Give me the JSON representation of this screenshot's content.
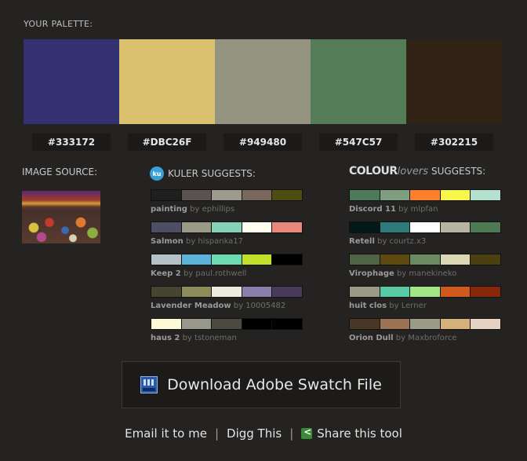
{
  "palette": {
    "heading": "YOUR PALETTE:",
    "colors": [
      "#333172",
      "#DBC26F",
      "#949480",
      "#547C57",
      "#302215"
    ]
  },
  "image_source": {
    "title": "IMAGE SOURCE:"
  },
  "kuler": {
    "icon_text": "ku",
    "title": "KULER SUGGESTS:",
    "suggestions": [
      {
        "name": "painting",
        "by": "by ephillips",
        "colors": [
          "#1f1f1f",
          "#5c5252",
          "#9d9b8e",
          "#7a675c",
          "#4d4c12"
        ]
      },
      {
        "name": "Salmon",
        "by": "by hispanka17",
        "colors": [
          "#4d4e63",
          "#9a9a86",
          "#86d1b8",
          "#fdfdf0",
          "#e8887a"
        ]
      },
      {
        "name": "Keep 2",
        "by": "by paul.rothwell",
        "colors": [
          "#b4c2c8",
          "#5cb2d8",
          "#6cdcb0",
          "#c0e02a",
          "#000000"
        ]
      },
      {
        "name": "Lavender Meadow",
        "by": "by 10005482",
        "colors": [
          "#464531",
          "#8f8c5b",
          "#ececde",
          "#8a7faa",
          "#4a3a5c"
        ]
      },
      {
        "name": "haus 2",
        "by": "by tstoneman",
        "colors": [
          "#fdfbd6",
          "#979889",
          "#4b4a42",
          "#000000",
          "#000000"
        ]
      }
    ]
  },
  "colourlovers": {
    "brand_bold": "COLOUR",
    "brand_light": "lovers",
    "title": "SUGGESTS:",
    "suggestions": [
      {
        "name": "Discord 11",
        "by": "by mlpfan",
        "colors": [
          "#4d7a58",
          "#7e9e80",
          "#ff7f2a",
          "#f8f74a",
          "#b4e0cf"
        ]
      },
      {
        "name": "Retell",
        "by": "by courtz.x3",
        "colors": [
          "#031818",
          "#2f7a7a",
          "#ffffff",
          "#b5b5a2",
          "#4d7a52"
        ]
      },
      {
        "name": "Virophage",
        "by": "by manekineko",
        "colors": [
          "#4e6445",
          "#5e4a0e",
          "#6a8a62",
          "#dad7b5",
          "#4c3f12"
        ]
      },
      {
        "name": "huit clos",
        "by": "by Lerner",
        "colors": [
          "#9a9a86",
          "#56cba3",
          "#a1e685",
          "#d2591d",
          "#87280a"
        ]
      },
      {
        "name": "Orion Dull",
        "by": "by Maxbroforce",
        "colors": [
          "#4a3624",
          "#9a7254",
          "#9b9c88",
          "#d5b07a",
          "#e6d2c0"
        ]
      }
    ]
  },
  "download": {
    "icon_text": "SWATCH",
    "label": "Download Adobe Swatch File"
  },
  "footer": {
    "email": "Email it to me",
    "sep1": "|",
    "digg": "Digg This",
    "sep2": "|",
    "share": "Share this tool"
  }
}
